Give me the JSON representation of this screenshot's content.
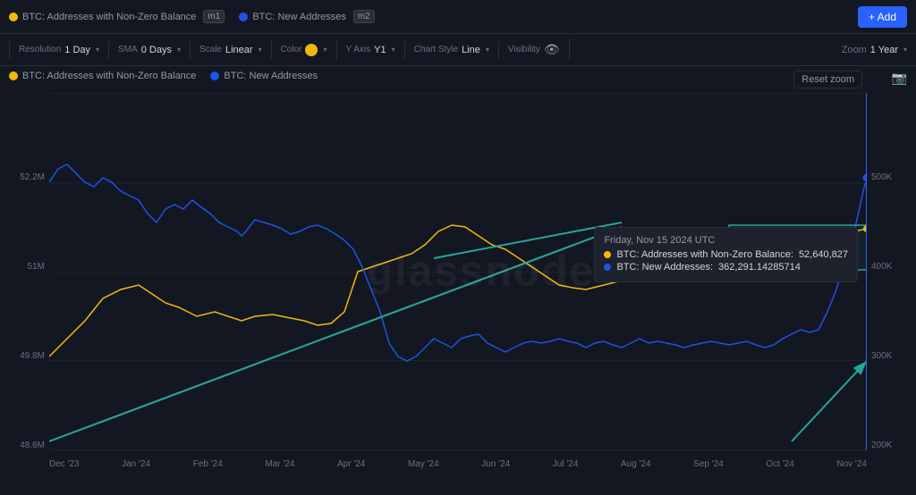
{
  "header": {
    "metric1": {
      "label": "BTC: Addresses with Non-Zero Balance",
      "badge": "m1",
      "color": "#f0b90b"
    },
    "metric2": {
      "label": "BTC: New Addresses",
      "badge": "m2",
      "color": "#1e53e5"
    },
    "add_button": "+ Add"
  },
  "toolbar": {
    "resolution": {
      "label": "Resolution",
      "value": "1 Day"
    },
    "sma": {
      "label": "SMA",
      "value": "0 Days"
    },
    "scale": {
      "label": "Scale",
      "value": "Linear"
    },
    "color": {
      "label": "Color",
      "value": ""
    },
    "y_axis": {
      "label": "Y Axis",
      "value": "Y1"
    },
    "chart_style": {
      "label": "Chart Style",
      "value": "Line"
    },
    "visibility": {
      "label": "Visibility",
      "value": ""
    },
    "zoom_label": "Zoom",
    "zoom_value": "1 Year"
  },
  "chart": {
    "watermark": "glassnode",
    "reset_zoom": "Reset zoom",
    "y_axis_left": [
      "52.2M",
      "51M",
      "49.8M",
      "48.6M"
    ],
    "y_axis_right": [
      "500K",
      "400K",
      "300K",
      "200K"
    ],
    "x_axis": [
      "Dec '23",
      "Jan '24",
      "Feb '24",
      "Mar '24",
      "Apr '24",
      "May '24",
      "Jun '24",
      "Jul '24",
      "Aug '24",
      "Sep '24",
      "Oct '24",
      "Nov '24"
    ]
  },
  "tooltip": {
    "date": "Friday, Nov 15 2024 UTC",
    "metric1_label": "BTC: Addresses with Non-Zero Balance:",
    "metric1_value": "52,640,827",
    "metric1_color": "#f0b90b",
    "metric2_label": "BTC: New Addresses:",
    "metric2_value": "362,291.14285714",
    "metric2_color": "#1e53e5"
  }
}
